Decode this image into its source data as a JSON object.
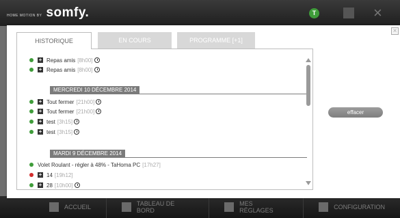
{
  "app": {
    "brand_tagline": "HOME MOTION BY",
    "brand_logo": "somfy.",
    "user_badge": "T"
  },
  "colors": {
    "success": "#3f9c3a",
    "error": "#d22c2c",
    "tab_inactive": "#d8d8d8",
    "day_header": "#7b7b7b"
  },
  "modal": {
    "tabs": [
      {
        "label": "HISTORIQUE"
      },
      {
        "label": "EN COURS"
      },
      {
        "label": "PROGRAMME [+1]"
      }
    ],
    "close_label": "×",
    "effacer_label": "effacer"
  },
  "history": {
    "top_items": [
      {
        "status": "success",
        "name": "Repas amis",
        "time": "[8h00]"
      },
      {
        "status": "success",
        "name": "Repas amis",
        "time": "[8h00]"
      }
    ],
    "day1": {
      "label": "MERCREDI 10 DÉCEMBRE 2014",
      "items": [
        {
          "status": "success",
          "name": "Tout fermer",
          "time": "[21h00]"
        },
        {
          "status": "success",
          "name": "Tout fermer",
          "time": "[21h00]"
        },
        {
          "status": "success",
          "name": "test",
          "time": "[3h15]"
        },
        {
          "status": "success",
          "name": "test",
          "time": "[3h15]"
        }
      ]
    },
    "day2": {
      "label": "MARDI 9 DÉCEMBRE 2014",
      "items": [
        {
          "status": "success",
          "name": "Volet Roulant - régler à 48% - TaHoma PC",
          "time": "[17h27]"
        },
        {
          "status": "error",
          "name": "14",
          "time": "[19h12]"
        },
        {
          "status": "success",
          "name": "28",
          "time": "[10h00]"
        }
      ]
    }
  },
  "nav": [
    {
      "label": "ACCUEIL",
      "icon": "home-icon"
    },
    {
      "label": "TABLEAU DE BORD",
      "icon": "dashboard-icon"
    },
    {
      "label": "MES RÉGLAGES",
      "icon": "user-icon"
    },
    {
      "label": "CONFIGURATION",
      "icon": "gear-icon"
    }
  ]
}
